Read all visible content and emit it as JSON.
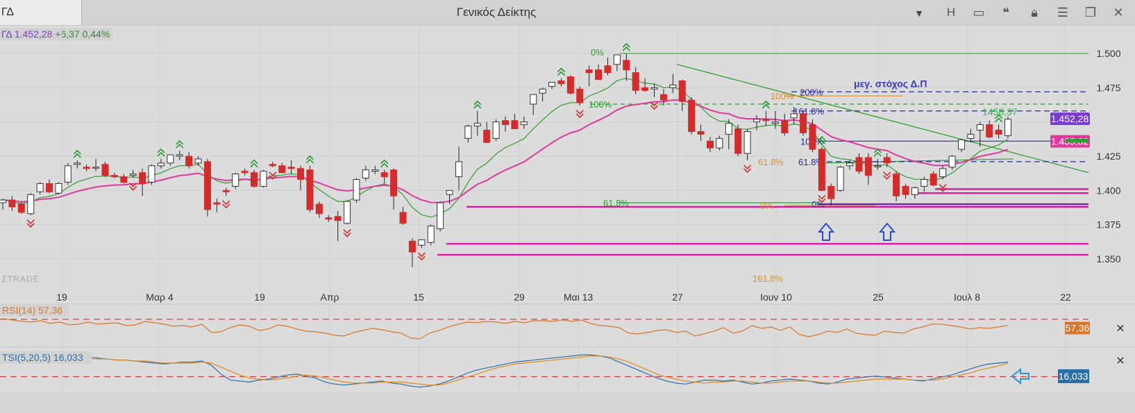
{
  "toolbar": {
    "symbol_tab": "ΓΔ",
    "title": "Γενικός Δείκτης",
    "h_button": "H"
  },
  "quote": {
    "symbol": "ΓΔ 1.452,28",
    "change": "+6,37 0,44%"
  },
  "watermark": "ZTRADE",
  "colors": {
    "up": "#ffffff",
    "down": "#d42b2b",
    "ma_fast": "#2e9e2e",
    "ma_slow": "#e0399e",
    "rsi": "#d9762a",
    "tsi": "#2b6fa8",
    "tsi_signal": "#e08a1a",
    "support": "#d620a8"
  },
  "chart_data": [
    {
      "type": "candlestick",
      "title": "Γενικός Δείκτης",
      "x_tick_labels": [
        "19",
        "Μαρ 4",
        "19",
        "Απρ",
        "15",
        "29",
        "Μαι 13",
        "27",
        "Ιουν 10",
        "25",
        "Ιουλ 8",
        "22"
      ],
      "y_tick_labels": [
        "1.500",
        "1.475",
        "1.425",
        "1.400",
        "1.375",
        "1.350"
      ],
      "ylim": [
        1342,
        1509
      ],
      "grid": true,
      "candles": [
        {
          "o": 1391,
          "h": 1394,
          "l": 1386,
          "c": 1393
        },
        {
          "o": 1393,
          "h": 1396,
          "l": 1385,
          "c": 1388
        },
        {
          "o": 1390,
          "h": 1392,
          "l": 1383,
          "c": 1384
        },
        {
          "o": 1383,
          "h": 1398,
          "l": 1382,
          "c": 1397
        },
        {
          "o": 1399,
          "h": 1406,
          "l": 1397,
          "c": 1405
        },
        {
          "o": 1405,
          "h": 1408,
          "l": 1398,
          "c": 1399
        },
        {
          "o": 1398,
          "h": 1406,
          "l": 1397,
          "c": 1405
        },
        {
          "o": 1406,
          "h": 1420,
          "l": 1404,
          "c": 1418
        },
        {
          "o": 1419,
          "h": 1422,
          "l": 1416,
          "c": 1420
        },
        {
          "o": 1417,
          "h": 1419,
          "l": 1414,
          "c": 1416
        },
        {
          "o": 1417,
          "h": 1423,
          "l": 1414,
          "c": 1417
        },
        {
          "o": 1419,
          "h": 1421,
          "l": 1410,
          "c": 1411
        },
        {
          "o": 1411,
          "h": 1413,
          "l": 1409,
          "c": 1410
        },
        {
          "o": 1410,
          "h": 1412,
          "l": 1405,
          "c": 1406
        },
        {
          "o": 1411,
          "h": 1415,
          "l": 1409,
          "c": 1412
        },
        {
          "o": 1413,
          "h": 1416,
          "l": 1396,
          "c": 1405
        },
        {
          "o": 1406,
          "h": 1419,
          "l": 1404,
          "c": 1418
        },
        {
          "o": 1418,
          "h": 1423,
          "l": 1416,
          "c": 1420
        },
        {
          "o": 1420,
          "h": 1425,
          "l": 1418,
          "c": 1426
        },
        {
          "o": 1425,
          "h": 1429,
          "l": 1422,
          "c": 1426
        },
        {
          "o": 1425,
          "h": 1428,
          "l": 1416,
          "c": 1418
        },
        {
          "o": 1420,
          "h": 1425,
          "l": 1418,
          "c": 1423
        },
        {
          "o": 1421,
          "h": 1423,
          "l": 1381,
          "c": 1386
        },
        {
          "o": 1391,
          "h": 1394,
          "l": 1384,
          "c": 1390
        },
        {
          "o": 1400,
          "h": 1402,
          "l": 1396,
          "c": 1399
        },
        {
          "o": 1403,
          "h": 1413,
          "l": 1401,
          "c": 1412
        },
        {
          "o": 1414,
          "h": 1416,
          "l": 1411,
          "c": 1413
        },
        {
          "o": 1413,
          "h": 1415,
          "l": 1402,
          "c": 1403
        },
        {
          "o": 1403,
          "h": 1415,
          "l": 1402,
          "c": 1414
        },
        {
          "o": 1419,
          "h": 1421,
          "l": 1417,
          "c": 1418
        },
        {
          "o": 1418,
          "h": 1420,
          "l": 1413,
          "c": 1413
        },
        {
          "o": 1417,
          "h": 1422,
          "l": 1412,
          "c": 1416
        },
        {
          "o": 1416,
          "h": 1418,
          "l": 1400,
          "c": 1408
        },
        {
          "o": 1415,
          "h": 1418,
          "l": 1384,
          "c": 1386
        },
        {
          "o": 1390,
          "h": 1392,
          "l": 1380,
          "c": 1383
        },
        {
          "o": 1380,
          "h": 1382,
          "l": 1377,
          "c": 1379
        },
        {
          "o": 1381,
          "h": 1385,
          "l": 1363,
          "c": 1378
        },
        {
          "o": 1376,
          "h": 1393,
          "l": 1375,
          "c": 1392
        },
        {
          "o": 1393,
          "h": 1409,
          "l": 1391,
          "c": 1408
        },
        {
          "o": 1409,
          "h": 1418,
          "l": 1407,
          "c": 1415
        },
        {
          "o": 1414,
          "h": 1418,
          "l": 1412,
          "c": 1415
        },
        {
          "o": 1413,
          "h": 1415,
          "l": 1405,
          "c": 1410
        },
        {
          "o": 1415,
          "h": 1416,
          "l": 1386,
          "c": 1396
        },
        {
          "o": 1384,
          "h": 1388,
          "l": 1375,
          "c": 1376
        },
        {
          "o": 1363,
          "h": 1365,
          "l": 1344,
          "c": 1355
        },
        {
          "o": 1360,
          "h": 1364,
          "l": 1358,
          "c": 1364
        },
        {
          "o": 1362,
          "h": 1375,
          "l": 1360,
          "c": 1374
        },
        {
          "o": 1372,
          "h": 1392,
          "l": 1370,
          "c": 1391
        },
        {
          "o": 1397,
          "h": 1400,
          "l": 1390,
          "c": 1400
        },
        {
          "o": 1410,
          "h": 1432,
          "l": 1400,
          "c": 1421
        },
        {
          "o": 1438,
          "h": 1448,
          "l": 1435,
          "c": 1447
        },
        {
          "o": 1447,
          "h": 1458,
          "l": 1440,
          "c": 1449
        },
        {
          "o": 1444,
          "h": 1450,
          "l": 1436,
          "c": 1435
        },
        {
          "o": 1438,
          "h": 1452,
          "l": 1436,
          "c": 1450
        },
        {
          "o": 1451,
          "h": 1454,
          "l": 1443,
          "c": 1448
        },
        {
          "o": 1451,
          "h": 1456,
          "l": 1445,
          "c": 1445
        },
        {
          "o": 1448,
          "h": 1454,
          "l": 1445,
          "c": 1450
        },
        {
          "o": 1463,
          "h": 1467,
          "l": 1455,
          "c": 1470
        },
        {
          "o": 1471,
          "h": 1475,
          "l": 1465,
          "c": 1474
        },
        {
          "o": 1476,
          "h": 1479,
          "l": 1474,
          "c": 1479
        },
        {
          "o": 1480,
          "h": 1482,
          "l": 1476,
          "c": 1478
        },
        {
          "o": 1483,
          "h": 1484,
          "l": 1470,
          "c": 1471
        },
        {
          "o": 1474,
          "h": 1476,
          "l": 1462,
          "c": 1464
        },
        {
          "o": 1488,
          "h": 1491,
          "l": 1476,
          "c": 1486
        },
        {
          "o": 1488,
          "h": 1492,
          "l": 1482,
          "c": 1481
        },
        {
          "o": 1491,
          "h": 1497,
          "l": 1484,
          "c": 1486
        },
        {
          "o": 1492,
          "h": 1498,
          "l": 1487,
          "c": 1499
        },
        {
          "o": 1495,
          "h": 1500,
          "l": 1480,
          "c": 1488
        },
        {
          "o": 1486,
          "h": 1490,
          "l": 1470,
          "c": 1473
        },
        {
          "o": 1475,
          "h": 1482,
          "l": 1472,
          "c": 1473
        },
        {
          "o": 1474,
          "h": 1478,
          "l": 1468,
          "c": 1475
        },
        {
          "o": 1470,
          "h": 1474,
          "l": 1462,
          "c": 1466
        },
        {
          "o": 1475,
          "h": 1485,
          "l": 1471,
          "c": 1477
        },
        {
          "o": 1480,
          "h": 1481,
          "l": 1458,
          "c": 1465
        },
        {
          "o": 1466,
          "h": 1468,
          "l": 1441,
          "c": 1443
        },
        {
          "o": 1443,
          "h": 1448,
          "l": 1436,
          "c": 1441
        },
        {
          "o": 1436,
          "h": 1439,
          "l": 1428,
          "c": 1431
        },
        {
          "o": 1431,
          "h": 1440,
          "l": 1429,
          "c": 1438
        },
        {
          "o": 1441,
          "h": 1452,
          "l": 1430,
          "c": 1449
        },
        {
          "o": 1445,
          "h": 1448,
          "l": 1425,
          "c": 1427
        },
        {
          "o": 1427,
          "h": 1445,
          "l": 1422,
          "c": 1443
        },
        {
          "o": 1450,
          "h": 1455,
          "l": 1444,
          "c": 1452
        },
        {
          "o": 1452,
          "h": 1458,
          "l": 1447,
          "c": 1451
        },
        {
          "o": 1449,
          "h": 1458,
          "l": 1445,
          "c": 1450
        },
        {
          "o": 1451,
          "h": 1456,
          "l": 1440,
          "c": 1442
        },
        {
          "o": 1453,
          "h": 1461,
          "l": 1448,
          "c": 1456
        },
        {
          "o": 1456,
          "h": 1458,
          "l": 1440,
          "c": 1442
        },
        {
          "o": 1448,
          "h": 1452,
          "l": 1428,
          "c": 1430
        },
        {
          "o": 1430,
          "h": 1432,
          "l": 1400,
          "c": 1400
        },
        {
          "o": 1403,
          "h": 1405,
          "l": 1389,
          "c": 1394
        },
        {
          "o": 1400,
          "h": 1418,
          "l": 1399,
          "c": 1417
        },
        {
          "o": 1418,
          "h": 1422,
          "l": 1415,
          "c": 1420
        },
        {
          "o": 1424,
          "h": 1427,
          "l": 1412,
          "c": 1414
        },
        {
          "o": 1424,
          "h": 1427,
          "l": 1404,
          "c": 1411
        },
        {
          "o": 1418,
          "h": 1423,
          "l": 1415,
          "c": 1418
        },
        {
          "o": 1424,
          "h": 1427,
          "l": 1417,
          "c": 1420
        },
        {
          "o": 1412,
          "h": 1414,
          "l": 1392,
          "c": 1396
        },
        {
          "o": 1403,
          "h": 1405,
          "l": 1394,
          "c": 1397
        },
        {
          "o": 1397,
          "h": 1403,
          "l": 1394,
          "c": 1402
        },
        {
          "o": 1403,
          "h": 1410,
          "l": 1399,
          "c": 1408
        },
        {
          "o": 1412,
          "h": 1414,
          "l": 1403,
          "c": 1404
        },
        {
          "o": 1410,
          "h": 1418,
          "l": 1408,
          "c": 1416
        },
        {
          "o": 1417,
          "h": 1426,
          "l": 1415,
          "c": 1425
        },
        {
          "o": 1430,
          "h": 1437,
          "l": 1428,
          "c": 1437
        },
        {
          "o": 1438,
          "h": 1445,
          "l": 1435,
          "c": 1441
        },
        {
          "o": 1444,
          "h": 1450,
          "l": 1432,
          "c": 1448
        },
        {
          "o": 1448,
          "h": 1451,
          "l": 1438,
          "c": 1439
        },
        {
          "o": 1444,
          "h": 1448,
          "l": 1438,
          "c": 1441
        },
        {
          "o": 1440,
          "h": 1454,
          "l": 1438,
          "c": 1452
        }
      ],
      "price_labels": [
        {
          "text": "1.452,28",
          "value": 1452.28,
          "color": "#7a3bd1"
        },
        {
          "text": "1.435,82",
          "value": 1435.82,
          "color": "#e0399e"
        }
      ],
      "annotations": [
        "μεγ. στόχος Δ.Π",
        "1458,37",
        "100%",
        "61.8%",
        "0%",
        "200%",
        "161.8%",
        "100%",
        "61.8%",
        "0%",
        "100%",
        "61.8%",
        "0%",
        "161.8%"
      ]
    },
    {
      "type": "line",
      "title": "RSI(14)",
      "label": "RSI(14)",
      "value_text": "57,36",
      "last_label": "57,36",
      "levels": [
        70,
        30
      ],
      "ylim": [
        20,
        80
      ],
      "values": [
        71,
        69,
        67,
        66,
        68,
        64,
        66,
        62,
        63,
        66,
        63,
        64,
        65,
        61,
        62,
        67,
        65,
        63,
        60,
        61,
        59,
        63,
        51,
        52,
        58,
        62,
        60,
        54,
        56,
        62,
        60,
        56,
        53,
        52,
        50,
        47,
        46,
        51,
        54,
        57,
        55,
        52,
        50,
        43,
        42,
        50,
        54,
        59,
        63,
        66,
        65,
        67,
        66,
        64,
        67,
        65,
        68,
        68,
        67,
        69,
        67,
        69,
        64,
        61,
        60,
        58,
        50,
        49,
        51,
        54,
        55,
        51,
        53,
        46,
        49,
        53,
        58,
        50,
        53,
        61,
        57,
        59,
        54,
        59,
        48,
        45,
        48,
        53,
        51,
        56,
        50,
        48,
        47,
        53,
        51,
        50,
        56,
        59,
        63,
        63,
        61,
        59,
        56,
        58,
        57,
        59,
        61
      ]
    },
    {
      "type": "line",
      "title": "TSI(5,20,5)",
      "label": "TSI(5,20,5)",
      "value_text": "16,033",
      "last_label": "16,033",
      "levels": [
        0
      ],
      "ylim": [
        -12,
        24
      ],
      "series": [
        {
          "name": "TSI(5,20,5)",
          "values": [
            22,
            22,
            21,
            20,
            21,
            19,
            18,
            19,
            20,
            21,
            20,
            19,
            18,
            18,
            17,
            16,
            15,
            14,
            15,
            16,
            16,
            17,
            13,
            4,
            -2,
            -3,
            -4,
            -2,
            -1,
            1,
            3,
            4,
            2,
            0,
            -4,
            -6,
            -7,
            -6,
            -5,
            -4,
            -3,
            -5,
            -6,
            -8,
            -9,
            -8,
            -6,
            -3,
            1,
            5,
            8,
            10,
            12,
            14,
            16,
            17,
            18,
            19,
            20,
            21,
            22,
            23,
            23,
            22,
            20,
            16,
            12,
            8,
            4,
            0,
            -3,
            -5,
            -6,
            -4,
            -2,
            -2,
            -3,
            -2,
            -4,
            -6,
            -5,
            -3,
            -2,
            -1,
            -2,
            -3,
            -5,
            -6,
            -4,
            -1,
            0,
            1,
            2,
            1,
            0,
            -1,
            -2,
            -3,
            -1,
            1,
            3,
            6,
            9,
            12,
            14,
            15,
            16
          ]
        },
        {
          "name": "",
          "values": [
            20,
            20,
            20,
            19,
            19,
            19,
            18,
            18,
            18,
            19,
            19,
            19,
            18,
            18,
            17,
            17,
            16,
            15,
            15,
            15,
            15,
            16,
            15,
            11,
            7,
            3,
            0,
            -1,
            -2,
            -1,
            0,
            2,
            3,
            2,
            0,
            -2,
            -4,
            -5,
            -5,
            -5,
            -4,
            -4,
            -4,
            -5,
            -6,
            -7,
            -7,
            -5,
            -2,
            1,
            4,
            7,
            10,
            12,
            14,
            15,
            16,
            17,
            18,
            19,
            20,
            21,
            22,
            22,
            21,
            19,
            16,
            12,
            8,
            4,
            1,
            -1,
            -3,
            -4,
            -5,
            -4,
            -4,
            -3,
            -3,
            -4,
            -5,
            -5,
            -4,
            -3,
            -3,
            -3,
            -4,
            -5,
            -5,
            -4,
            -3,
            -2,
            -1,
            -1,
            -1,
            -1,
            -2,
            -2,
            -2,
            -1,
            1,
            3,
            5,
            8,
            10,
            12,
            15
          ]
        }
      ]
    }
  ]
}
